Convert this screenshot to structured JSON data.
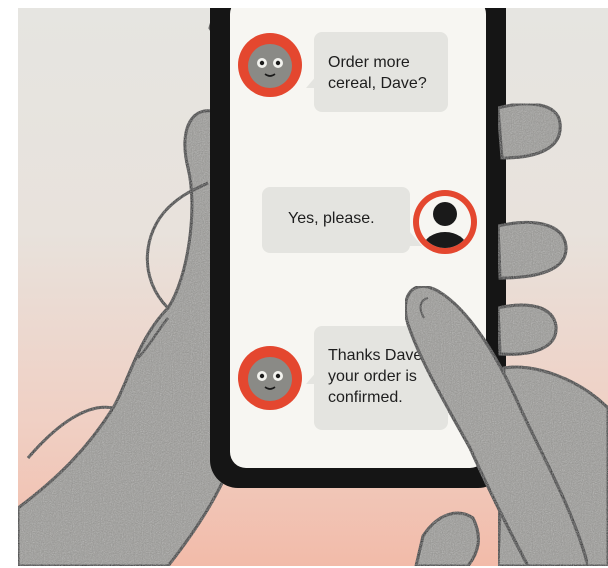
{
  "messages": [
    {
      "from": "bot",
      "lines": [
        "Order more",
        "cereal, Dave?"
      ]
    },
    {
      "from": "user",
      "lines": [
        "Yes, please."
      ]
    },
    {
      "from": "bot",
      "lines": [
        "Thanks Dave,",
        "your order is",
        "confirmed."
      ]
    }
  ],
  "colors": {
    "background_top": "#e6e5e1",
    "background_bottom": "#f2bba9",
    "phone_body": "#151515",
    "screen": "#f7f6f2",
    "bubble": "#e4e4e0",
    "bot_avatar_ring": "#e4472f",
    "bot_face": "#8a8a86",
    "user_avatar_ring": "#e4472f",
    "hand": "#9a9995",
    "outline": "#111111"
  },
  "icons": {
    "bot_avatar": "robot-face-icon",
    "user_avatar": "person-silhouette-icon"
  }
}
